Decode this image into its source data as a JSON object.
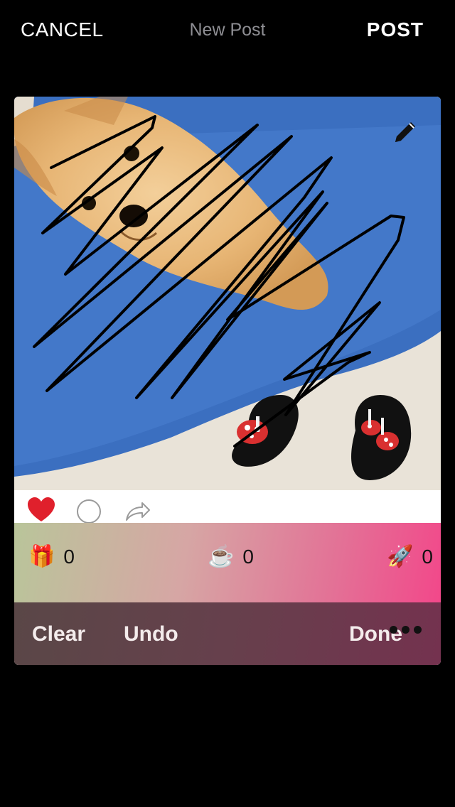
{
  "nav": {
    "cancel_label": "CANCEL",
    "title": "New Post",
    "post_label": "POST"
  },
  "image": {
    "subject": "pomeranian puppy on blue rug with black slippers",
    "drawing": "black freehand scribble overlay",
    "edit_icon": "pencil-icon"
  },
  "actions": {
    "like_icon": "heart-icon",
    "comment_icon": "comment-bubble-icon",
    "share_icon": "share-arrow-icon",
    "like_color": "#e0202c"
  },
  "reactions": [
    {
      "icon": "gift-icon",
      "emoji": "🎁",
      "count": "0"
    },
    {
      "icon": "coffee-icon",
      "emoji": "☕",
      "count": "0"
    },
    {
      "icon": "rocket-icon",
      "emoji": "🚀",
      "count": "0"
    }
  ],
  "draw_toolbar": {
    "clear_label": "Clear",
    "undo_label": "Undo",
    "done_label": "Done",
    "more_icon": "more-dots-icon"
  },
  "colors": {
    "background": "#000000",
    "gradient_start": "#b9c59a",
    "gradient_end": "#f2488a",
    "toolbar_dark": "#5a4747"
  }
}
